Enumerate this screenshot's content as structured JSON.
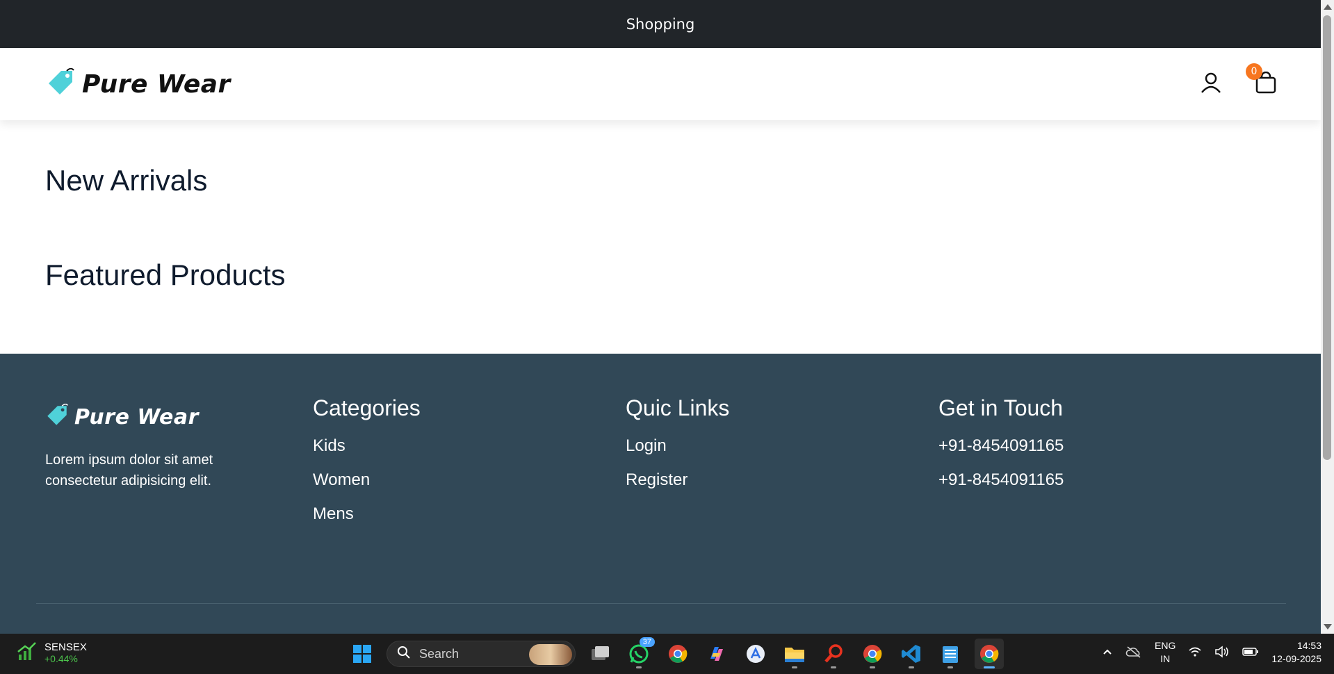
{
  "browser": {
    "tab_title": "Shopping"
  },
  "header": {
    "brand": "Pure Wear",
    "cart_count": "0"
  },
  "main": {
    "sections": [
      "New Arrivals",
      "Featured Products"
    ]
  },
  "footer": {
    "brand": "Pure Wear",
    "description": "Lorem ipsum dolor sit amet consectetur adipisicing elit.",
    "categories": {
      "title": "Categories",
      "items": [
        "Kids",
        "Women",
        "Mens"
      ]
    },
    "quick_links": {
      "title": "Quic Links",
      "items": [
        "Login",
        "Register"
      ]
    },
    "contact": {
      "title": "Get in Touch",
      "items": [
        "+91-8454091165",
        "+91-8454091165"
      ]
    }
  },
  "taskbar": {
    "ticker": {
      "name": "SENSEX",
      "change": "+0.44%"
    },
    "search_placeholder": "Search",
    "whatsapp_badge": "37",
    "language": [
      "ENG",
      "IN"
    ],
    "time": "14:53",
    "date": "12-09-2025"
  },
  "colors": {
    "topbar": "#212529",
    "footer": "#314857",
    "accent": "#f7761f",
    "tag": "#4fd1d9"
  }
}
